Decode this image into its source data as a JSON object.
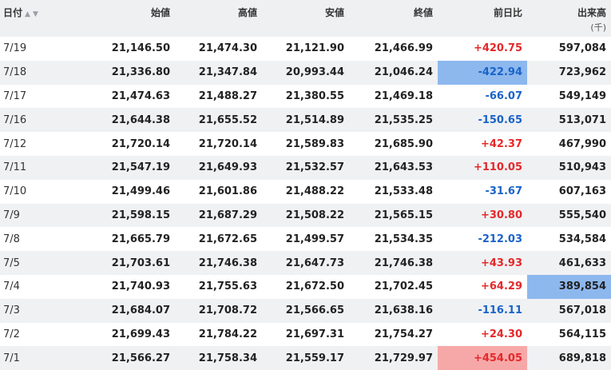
{
  "header": {
    "date": "日付",
    "sort_up": "▲",
    "sort_down": "▼",
    "open": "始値",
    "high": "高値",
    "low": "安値",
    "close": "終値",
    "change": "前日比",
    "volume": "出来高",
    "volume_unit": "(千)"
  },
  "rows": [
    {
      "date": "7/19",
      "open": "21,146.50",
      "high": "21,474.30",
      "low": "21,121.90",
      "close": "21,466.99",
      "change": "+420.75",
      "volume": "597,084"
    },
    {
      "date": "7/18",
      "open": "21,336.80",
      "high": "21,347.84",
      "low": "20,993.44",
      "close": "21,046.24",
      "change": "-422.94",
      "volume": "723,962"
    },
    {
      "date": "7/17",
      "open": "21,474.63",
      "high": "21,488.27",
      "low": "21,380.55",
      "close": "21,469.18",
      "change": "-66.07",
      "volume": "549,149"
    },
    {
      "date": "7/16",
      "open": "21,644.38",
      "high": "21,655.52",
      "low": "21,514.89",
      "close": "21,535.25",
      "change": "-150.65",
      "volume": "513,071"
    },
    {
      "date": "7/12",
      "open": "21,720.14",
      "high": "21,720.14",
      "low": "21,589.83",
      "close": "21,685.90",
      "change": "+42.37",
      "volume": "467,990"
    },
    {
      "date": "7/11",
      "open": "21,547.19",
      "high": "21,649.93",
      "low": "21,532.57",
      "close": "21,643.53",
      "change": "+110.05",
      "volume": "510,943"
    },
    {
      "date": "7/10",
      "open": "21,499.46",
      "high": "21,601.86",
      "low": "21,488.22",
      "close": "21,533.48",
      "change": "-31.67",
      "volume": "607,163"
    },
    {
      "date": "7/9",
      "open": "21,598.15",
      "high": "21,687.29",
      "low": "21,508.22",
      "close": "21,565.15",
      "change": "+30.80",
      "volume": "555,540"
    },
    {
      "date": "7/8",
      "open": "21,665.79",
      "high": "21,672.65",
      "low": "21,499.57",
      "close": "21,534.35",
      "change": "-212.03",
      "volume": "534,584"
    },
    {
      "date": "7/5",
      "open": "21,703.61",
      "high": "21,746.38",
      "low": "21,647.73",
      "close": "21,746.38",
      "change": "+43.93",
      "volume": "461,633"
    },
    {
      "date": "7/4",
      "open": "21,740.93",
      "high": "21,755.63",
      "low": "21,672.50",
      "close": "21,702.45",
      "change": "+64.29",
      "volume": "389,854"
    },
    {
      "date": "7/3",
      "open": "21,684.07",
      "high": "21,708.72",
      "low": "21,566.65",
      "close": "21,638.16",
      "change": "-116.11",
      "volume": "567,018"
    },
    {
      "date": "7/2",
      "open": "21,699.43",
      "high": "21,784.22",
      "low": "21,697.31",
      "close": "21,754.27",
      "change": "+24.30",
      "volume": "564,115"
    },
    {
      "date": "7/1",
      "open": "21,566.27",
      "high": "21,758.34",
      "low": "21,559.17",
      "close": "21,729.97",
      "change": "+454.05",
      "volume": "689,818"
    }
  ],
  "colors": {
    "up": "#e5282a",
    "down": "#1a63c8",
    "highlight_blue": "#8db8ee",
    "highlight_red": "#f6a8a8"
  }
}
